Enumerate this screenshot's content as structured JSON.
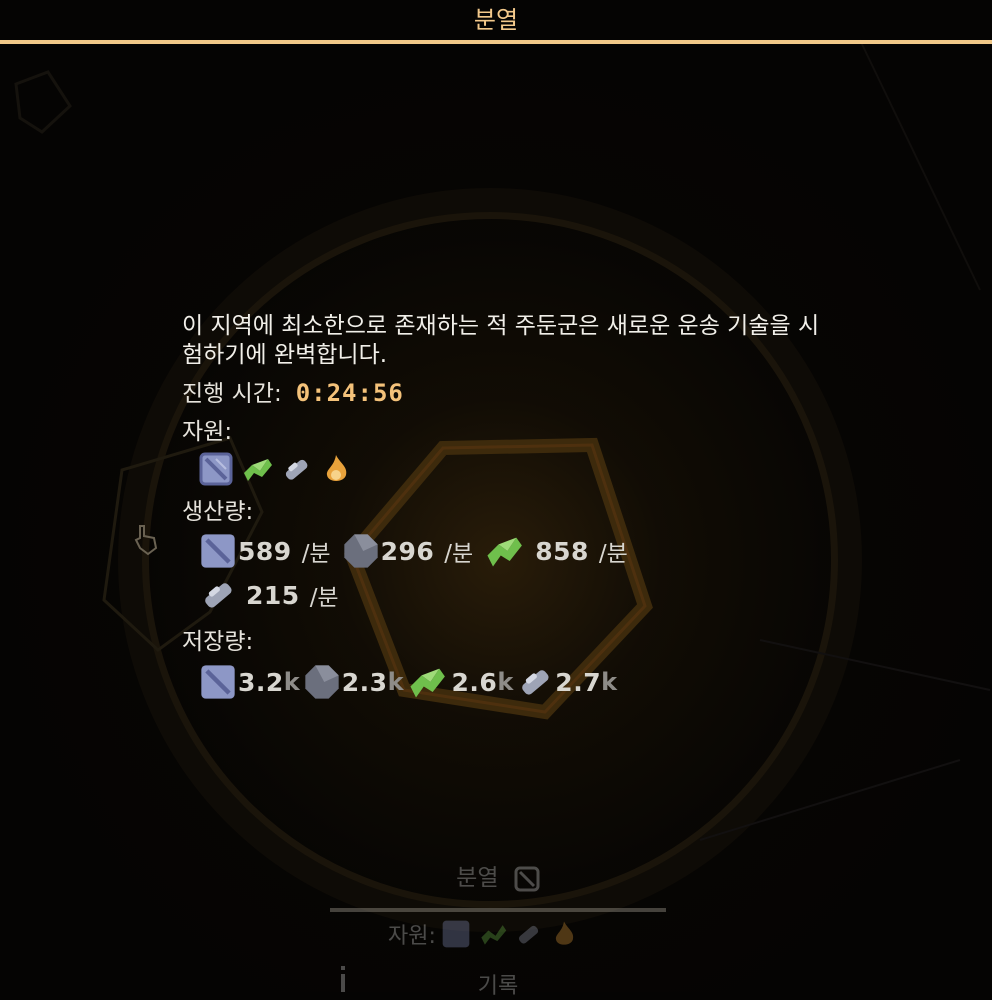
{
  "header": {
    "title": "분열"
  },
  "sector": {
    "description": "이 지역에 최소한으로 존재하는 적 주둔군은 새로운 운송 기술을 시험하기에 완벽합니다.",
    "elapsed_label": "진행 시간:",
    "elapsed_value": "0:24:56",
    "resources_label": "자원:",
    "resources": [
      "lead-icon",
      "titanium-icon",
      "silicon-icon",
      "spore-icon"
    ],
    "production_label": "생산량:",
    "production": [
      {
        "icon": "lead-icon",
        "value": "589",
        "unit": "/분"
      },
      {
        "icon": "scrap-icon",
        "value": "296",
        "unit": "/분"
      },
      {
        "icon": "titanium-icon",
        "value": "858",
        "unit": "/분"
      },
      {
        "icon": "silicon-icon",
        "value": "215",
        "unit": "/분"
      }
    ],
    "storage_label": "저장량:",
    "storage": [
      {
        "icon": "lead-icon",
        "value": "3.2",
        "suffix": "k"
      },
      {
        "icon": "scrap-icon",
        "value": "2.3",
        "suffix": "k"
      },
      {
        "icon": "titanium-icon",
        "value": "2.6",
        "suffix": "k"
      },
      {
        "icon": "silicon-icon",
        "value": "2.7",
        "suffix": "k"
      }
    ]
  },
  "bottom_panel": {
    "title": "분열",
    "resources_label": "자원:",
    "record_label": "기록"
  },
  "colors": {
    "accent": "#f1c888",
    "timer": "#f4c27a",
    "text": "#e6e3dc",
    "lead": "#8d97c6",
    "titanium": "#6fbf4c",
    "silicon": "#9ea4b6",
    "scrap": "#6b6f7d",
    "spore": "#e8a23b"
  }
}
